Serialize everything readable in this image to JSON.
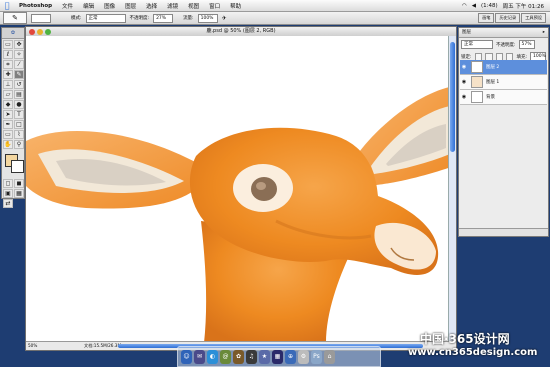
{
  "menubar": {
    "apple": "",
    "items": [
      "Photoshop",
      "文件",
      "编辑",
      "图像",
      "图层",
      "选择",
      "滤镜",
      "视图",
      "窗口",
      "帮助"
    ],
    "status": "(1:48)",
    "clock": "周五 下午 01:26"
  },
  "options": {
    "mode_label": "模式:",
    "mode_value": "正常",
    "opacity_label": "不透明度:",
    "opacity_value": "27%",
    "flow_label": "流量:",
    "flow_value": "100%",
    "well_tabs": [
      "画笔",
      "历史记录",
      "工具预设"
    ]
  },
  "document": {
    "title": "鹿.psd @ 50% (图层 2, RGB)",
    "zoom": "50%",
    "info": "文档:15.5M/26.3M"
  },
  "layers": {
    "tabs": "图层",
    "blend_mode": "正常",
    "opacity_label": "不透明度:",
    "opacity": "57%",
    "lock_label": "锁定:",
    "fill_label": "填充:",
    "fill": "100%",
    "items": [
      {
        "name": "图层 2"
      },
      {
        "name": "图层 1"
      },
      {
        "name": "背景"
      }
    ]
  },
  "watermark": {
    "line1": "中国·365设计网",
    "line2": "www.cn365design.com"
  },
  "colors": {
    "foreground": "#f3d6a0",
    "background": "#ffffff",
    "selection": "#5d8fdc",
    "desktop": "#1e3d72"
  }
}
